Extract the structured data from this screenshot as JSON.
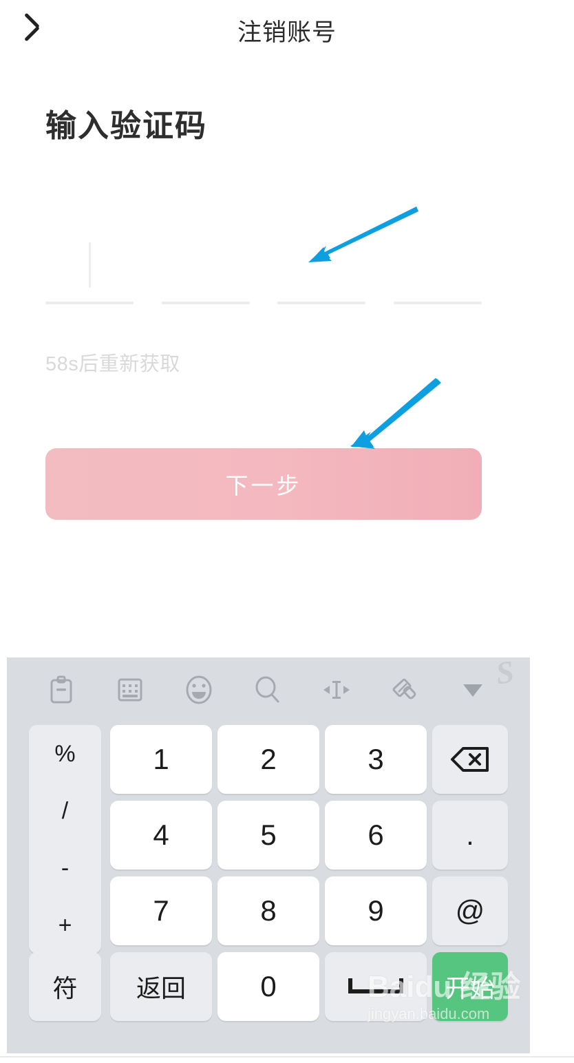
{
  "header": {
    "title": "注销账号",
    "back_icon": "chevron-left-icon"
  },
  "main": {
    "page_title": "输入验证码",
    "code_input": {
      "cells": [
        "",
        "",
        "",
        ""
      ],
      "focused_index": 0,
      "length": 4
    },
    "resend_label": "58s后重新获取",
    "next_button_label": "下一步",
    "next_button_color": "#f2b8bf",
    "next_button_disabled": true
  },
  "annotations": {
    "arrow_color": "#0e9fe0",
    "arrows": [
      {
        "name": "arrow-to-code-input",
        "target": "code-input"
      },
      {
        "name": "arrow-to-next-button",
        "target": "next-button"
      }
    ]
  },
  "keyboard": {
    "type": "numeric-sogou",
    "background": "#d9dce0",
    "brand": "S",
    "toolbar": [
      {
        "icon": "clipboard-icon",
        "label": "剪贴板"
      },
      {
        "icon": "keyboard-icon",
        "label": "键盘"
      },
      {
        "icon": "emoji-icon",
        "label": "表情"
      },
      {
        "icon": "search-icon",
        "label": "搜索"
      },
      {
        "icon": "cursor-move-icon",
        "label": "移动光标"
      },
      {
        "icon": "brush-icon",
        "label": "皮肤"
      },
      {
        "icon": "chevron-down-icon",
        "label": "收起键盘"
      }
    ],
    "symbol_column": [
      "%",
      "/",
      "-",
      "+"
    ],
    "keys": [
      {
        "label": "1",
        "style": "white"
      },
      {
        "label": "2",
        "style": "white"
      },
      {
        "label": "3",
        "style": "white"
      },
      {
        "label": "backspace-icon",
        "style": "light",
        "icon": true
      },
      {
        "label": "4",
        "style": "white"
      },
      {
        "label": "5",
        "style": "white"
      },
      {
        "label": "6",
        "style": "white"
      },
      {
        "label": ".",
        "style": "light"
      },
      {
        "label": "7",
        "style": "white"
      },
      {
        "label": "8",
        "style": "white"
      },
      {
        "label": "9",
        "style": "white"
      },
      {
        "label": "@",
        "style": "light"
      },
      {
        "label": "符",
        "style": "light"
      },
      {
        "label": "返回",
        "style": "light"
      },
      {
        "label": "0",
        "style": "white"
      },
      {
        "label": "space-icon",
        "style": "light",
        "icon": true
      },
      {
        "label": "开始",
        "style": "green"
      }
    ]
  },
  "watermark": {
    "main": "Baidu 经验",
    "sub": "jingyan.baidu.com"
  }
}
